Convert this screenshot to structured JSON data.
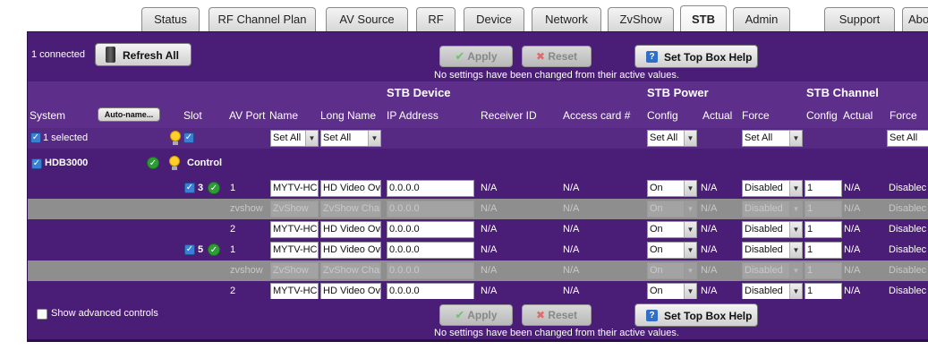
{
  "tabs": [
    {
      "label": "Status",
      "active": false
    },
    {
      "label": "RF Channel Plan",
      "active": false
    },
    {
      "label": "AV Source",
      "active": false
    },
    {
      "label": "RF",
      "active": false
    },
    {
      "label": "Device",
      "active": false
    },
    {
      "label": "Network",
      "active": false
    },
    {
      "label": "ZvShow",
      "active": false
    },
    {
      "label": "STB",
      "active": true
    },
    {
      "label": "Admin",
      "active": false
    },
    {
      "label": "Support",
      "active": false
    },
    {
      "label": "Abo",
      "active": false
    }
  ],
  "toolbar": {
    "connected_text": "1 connected",
    "refresh_label": "Refresh All",
    "apply_label": "Apply",
    "reset_label": "Reset",
    "help_label": "Set Top Box Help",
    "status_message": "No settings have been changed from their active values."
  },
  "sections": {
    "stb_device": "STB Device",
    "stb_power": "STB Power",
    "stb_channel": "STB Channel"
  },
  "columns": {
    "system": "System",
    "auto_name": "Auto-name...",
    "slot": "Slot",
    "av_port": "AV Port",
    "name": "Name",
    "long_name": "Long Name",
    "ip_address": "IP Address",
    "receiver_id": "Receiver ID",
    "access_card": "Access card #",
    "power_config": "Config",
    "power_actual": "Actual",
    "power_force": "Force",
    "chan_config": "Config",
    "chan_actual": "Actual",
    "chan_force": "Force"
  },
  "select_row": {
    "selected_text": "1 selected",
    "name_set": "Set All",
    "longname_set": "Set All",
    "power_config_set": "Set All",
    "power_force_set": "Set All",
    "chan_force_set": "Set All"
  },
  "system": {
    "name": "HDB3000",
    "control_label": "Control"
  },
  "slots": [
    {
      "number": "3"
    },
    {
      "number": "5"
    }
  ],
  "rows": [
    {
      "kind": "data",
      "port": "1",
      "name": "MYTV-HC",
      "long_name": "HD Video Ov",
      "ip": "0.0.0.0",
      "receiver": "N/A",
      "card": "N/A",
      "p_config": "On",
      "p_actual": "N/A",
      "p_force": "Disabled",
      "c_config": "1",
      "c_actual": "N/A",
      "c_force": "Disablec"
    },
    {
      "kind": "zv",
      "port": "zvshow",
      "name": "ZvShow",
      "long_name": "ZvShow Chan",
      "ip": "0.0.0.0",
      "receiver": "N/A",
      "card": "N/A",
      "p_config": "On",
      "p_actual": "N/A",
      "p_force": "Disabled",
      "c_config": "1",
      "c_actual": "N/A",
      "c_force": "Disablec"
    },
    {
      "kind": "data",
      "port": "2",
      "name": "MYTV-HC",
      "long_name": "HD Video Ov",
      "ip": "0.0.0.0",
      "receiver": "N/A",
      "card": "N/A",
      "p_config": "On",
      "p_actual": "N/A",
      "p_force": "Disabled",
      "c_config": "1",
      "c_actual": "N/A",
      "c_force": "Disablec"
    },
    {
      "kind": "data",
      "port": "1",
      "name": "MYTV-HC",
      "long_name": "HD Video Ov",
      "ip": "0.0.0.0",
      "receiver": "N/A",
      "card": "N/A",
      "p_config": "On",
      "p_actual": "N/A",
      "p_force": "Disabled",
      "c_config": "1",
      "c_actual": "N/A",
      "c_force": "Disablec"
    },
    {
      "kind": "zv",
      "port": "zvshow",
      "name": "ZvShow",
      "long_name": "ZvShow Chan",
      "ip": "0.0.0.0",
      "receiver": "N/A",
      "card": "N/A",
      "p_config": "On",
      "p_actual": "N/A",
      "p_force": "Disabled",
      "c_config": "1",
      "c_actual": "N/A",
      "c_force": "Disablec"
    },
    {
      "kind": "data",
      "port": "2",
      "name": "MYTV-HC",
      "long_name": "HD Video Ov",
      "ip": "0.0.0.0",
      "receiver": "N/A",
      "card": "N/A",
      "p_config": "On",
      "p_actual": "N/A",
      "p_force": "Disabled",
      "c_config": "1",
      "c_actual": "N/A",
      "c_force": "Disablec"
    }
  ],
  "footer": {
    "advanced_label": "Show advanced controls"
  }
}
